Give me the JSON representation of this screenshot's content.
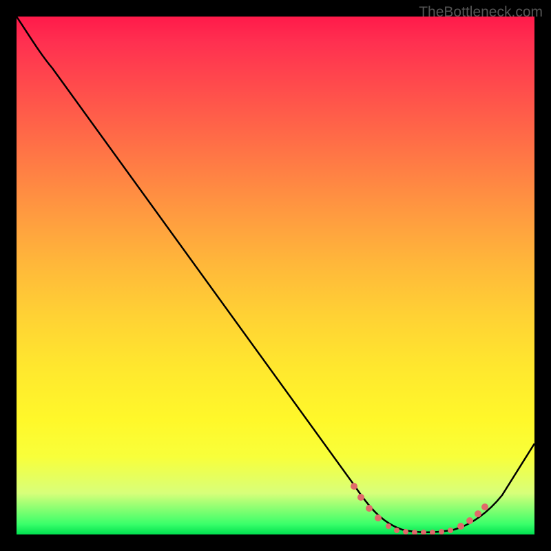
{
  "watermark": "TheBottleneck.com",
  "chart_data": {
    "type": "line",
    "title": "",
    "xlabel": "",
    "ylabel": "",
    "xlim": [
      0,
      100
    ],
    "ylim": [
      0,
      100
    ],
    "series": [
      {
        "name": "curve",
        "points": [
          {
            "x": 0,
            "y": 100
          },
          {
            "x": 5,
            "y": 94
          },
          {
            "x": 10,
            "y": 88
          },
          {
            "x": 20,
            "y": 73
          },
          {
            "x": 30,
            "y": 57
          },
          {
            "x": 40,
            "y": 42
          },
          {
            "x": 50,
            "y": 27
          },
          {
            "x": 60,
            "y": 12
          },
          {
            "x": 65,
            "y": 5
          },
          {
            "x": 70,
            "y": 1
          },
          {
            "x": 75,
            "y": 0
          },
          {
            "x": 80,
            "y": 0
          },
          {
            "x": 85,
            "y": 1
          },
          {
            "x": 90,
            "y": 5
          },
          {
            "x": 95,
            "y": 12
          },
          {
            "x": 100,
            "y": 20
          }
        ]
      },
      {
        "name": "dotted-segment",
        "points": [
          {
            "x": 65,
            "y": 5
          },
          {
            "x": 67,
            "y": 3
          },
          {
            "x": 70,
            "y": 1
          },
          {
            "x": 73,
            "y": 0.5
          },
          {
            "x": 76,
            "y": 0.3
          },
          {
            "x": 79,
            "y": 0.3
          },
          {
            "x": 82,
            "y": 0.5
          },
          {
            "x": 85,
            "y": 1
          },
          {
            "x": 87,
            "y": 2
          },
          {
            "x": 89,
            "y": 4
          }
        ]
      }
    ],
    "gradient_stops": [
      {
        "pos": 0,
        "color": "#ff1a4a"
      },
      {
        "pos": 50,
        "color": "#ffd234"
      },
      {
        "pos": 95,
        "color": "#f0ff40"
      },
      {
        "pos": 100,
        "color": "#00e050"
      }
    ]
  }
}
